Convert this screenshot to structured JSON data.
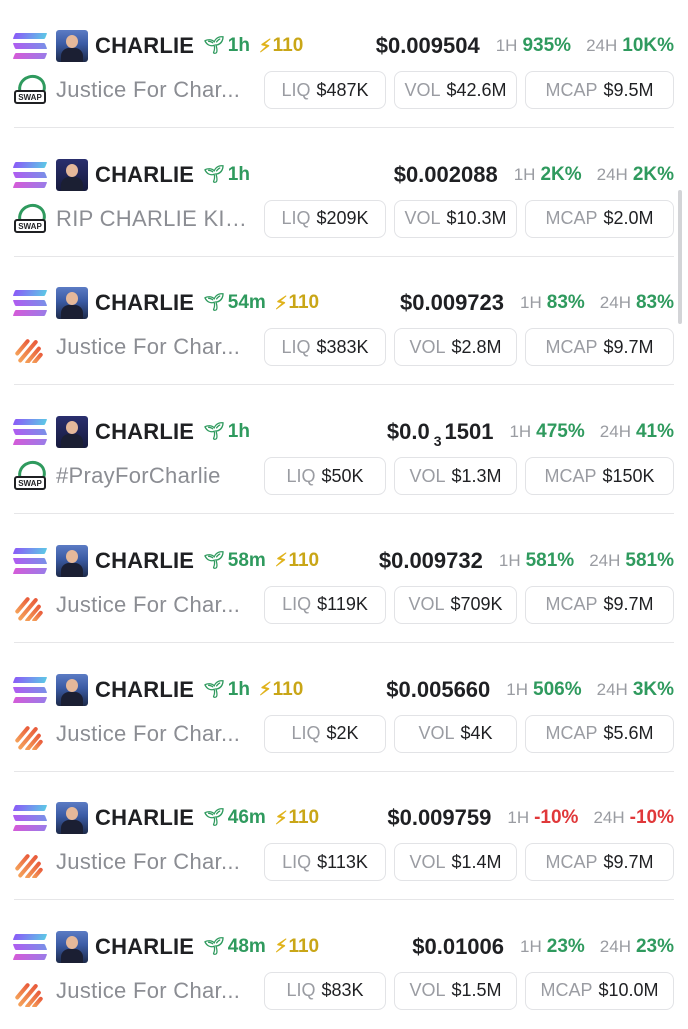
{
  "rows": [
    {
      "ticker": "CHARLIE",
      "age": "1h",
      "score": "110",
      "price": "$0.009504",
      "change_1h_label": "1H",
      "change_1h": "935%",
      "change_24h_label": "24H",
      "change_24h": "10K%",
      "name": "Justice For Char...",
      "dex": "swap",
      "avatar": "light",
      "liq_label": "LIQ",
      "liq": "$487K",
      "vol_label": "VOL",
      "vol": "$42.6M",
      "mcap_label": "MCAP",
      "mcap": "$9.5M"
    },
    {
      "ticker": "CHARLIE",
      "age": "1h",
      "score": "",
      "price": "$0.002088",
      "change_1h_label": "1H",
      "change_1h": "2K%",
      "change_24h_label": "24H",
      "change_24h": "2K%",
      "name": "RIP CHARLIE KIRK",
      "dex": "swap",
      "avatar": "dark",
      "liq_label": "LIQ",
      "liq": "$209K",
      "vol_label": "VOL",
      "vol": "$10.3M",
      "mcap_label": "MCAP",
      "mcap": "$2.0M"
    },
    {
      "ticker": "CHARLIE",
      "age": "54m",
      "score": "110",
      "price": "$0.009723",
      "change_1h_label": "1H",
      "change_1h": "83%",
      "change_24h_label": "24H",
      "change_24h": "83%",
      "name": "Justice For Char...",
      "dex": "stripes",
      "avatar": "light",
      "liq_label": "LIQ",
      "liq": "$383K",
      "vol_label": "VOL",
      "vol": "$2.8M",
      "mcap_label": "MCAP",
      "mcap": "$9.7M"
    },
    {
      "ticker": "CHARLIE",
      "age": "1h",
      "score": "",
      "price_main": "$0.0",
      "price_sub": "3",
      "price_tail": "1501",
      "change_1h_label": "1H",
      "change_1h": "475%",
      "change_24h_label": "24H",
      "change_24h": "41%",
      "name": "#PrayForCharlie",
      "dex": "swap",
      "avatar": "dark",
      "liq_label": "LIQ",
      "liq": "$50K",
      "vol_label": "VOL",
      "vol": "$1.3M",
      "mcap_label": "MCAP",
      "mcap": "$150K"
    },
    {
      "ticker": "CHARLIE",
      "age": "58m",
      "score": "110",
      "price": "$0.009732",
      "change_1h_label": "1H",
      "change_1h": "581%",
      "change_24h_label": "24H",
      "change_24h": "581%",
      "name": "Justice For Char...",
      "dex": "stripes",
      "avatar": "light",
      "liq_label": "LIQ",
      "liq": "$119K",
      "vol_label": "VOL",
      "vol": "$709K",
      "mcap_label": "MCAP",
      "mcap": "$9.7M"
    },
    {
      "ticker": "CHARLIE",
      "age": "1h",
      "score": "110",
      "price": "$0.005660",
      "change_1h_label": "1H",
      "change_1h": "506%",
      "change_24h_label": "24H",
      "change_24h": "3K%",
      "name": "Justice For Char...",
      "dex": "stripes",
      "avatar": "light",
      "liq_label": "LIQ",
      "liq": "$2K",
      "vol_label": "VOL",
      "vol": "$4K",
      "mcap_label": "MCAP",
      "mcap": "$5.6M"
    },
    {
      "ticker": "CHARLIE",
      "age": "46m",
      "score": "110",
      "price": "$0.009759",
      "change_1h_label": "1H",
      "change_1h": "-10%",
      "change_24h_label": "24H",
      "change_24h": "-10%",
      "name": "Justice For Char...",
      "dex": "stripes",
      "avatar": "light",
      "liq_label": "LIQ",
      "liq": "$113K",
      "vol_label": "VOL",
      "vol": "$1.4M",
      "mcap_label": "MCAP",
      "mcap": "$9.7M"
    },
    {
      "ticker": "CHARLIE",
      "age": "48m",
      "score": "110",
      "price": "$0.01006",
      "change_1h_label": "1H",
      "change_1h": "23%",
      "change_24h_label": "24H",
      "change_24h": "23%",
      "name": "Justice For Char...",
      "dex": "stripes",
      "avatar": "light",
      "liq_label": "LIQ",
      "liq": "$83K",
      "vol_label": "VOL",
      "vol": "$1.5M",
      "mcap_label": "MCAP",
      "mcap": "$10.0M"
    }
  ],
  "colors": {
    "positive": "#2f9a5e",
    "negative": "#e0383a",
    "score": "#c9a617",
    "text": "#1f2023",
    "muted": "#9a9ca2"
  },
  "icons": {
    "chain": "solana-icon",
    "age": "sprout-icon",
    "score": "bolt-icon",
    "dex_swap": "swap-dex-icon",
    "dex_stripes": "stripes-dex-icon"
  }
}
